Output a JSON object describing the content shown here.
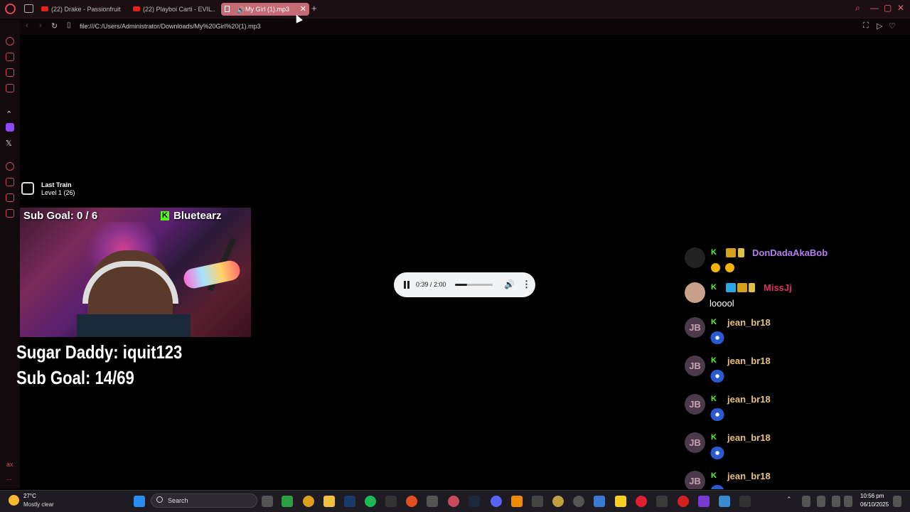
{
  "browser": {
    "tabs": [
      {
        "label": "(22) Drake - Passionfruit"
      },
      {
        "label": "(22) Playboi Carti - EVIL..."
      },
      {
        "label": "My Girl (1).mp3"
      }
    ],
    "url": "file:///C:/Users/Administrator/Downloads/My%20Girl%20(1).mp3",
    "accent": "#e0445a"
  },
  "sidebar": {
    "footer_text": "ax",
    "more": "..."
  },
  "overlay": {
    "train_title": "Last Train",
    "train_level": "Level 1  (26)",
    "cam_sub_goal": "Sub Goal:  0 / 6",
    "cam_kick_k": "K",
    "cam_name": "Bluetearz",
    "sugar_daddy": "Sugar Daddy: iquit123",
    "sub_goal": "Sub Goal: 14/69"
  },
  "player": {
    "time": "0:39 / 2:00",
    "progress": 0.325
  },
  "chat": [
    {
      "user": "DonDadaAkaBob",
      "color": "#b37feb",
      "msg": "",
      "avatar": ""
    },
    {
      "user": "MissJj",
      "color": "#e0315f",
      "msg": "looool",
      "avatar": ""
    },
    {
      "user": "jean_br18",
      "color": "#e6c07b",
      "msg": "",
      "avatar": "JB"
    },
    {
      "user": "jean_br18",
      "color": "#e6c07b",
      "msg": "",
      "avatar": "JB"
    },
    {
      "user": "jean_br18",
      "color": "#e6c07b",
      "msg": "",
      "avatar": "JB"
    },
    {
      "user": "jean_br18",
      "color": "#e6c07b",
      "msg": "",
      "avatar": "JB"
    },
    {
      "user": "jean_br18",
      "color": "#e6c07b",
      "msg": "",
      "avatar": "JB"
    }
  ],
  "chat_badge_k": "K",
  "taskbar": {
    "temp": "27°C",
    "weather": "Mostly clear",
    "search": "Search",
    "time": "10:56 pm",
    "date": "06/10/2025"
  }
}
